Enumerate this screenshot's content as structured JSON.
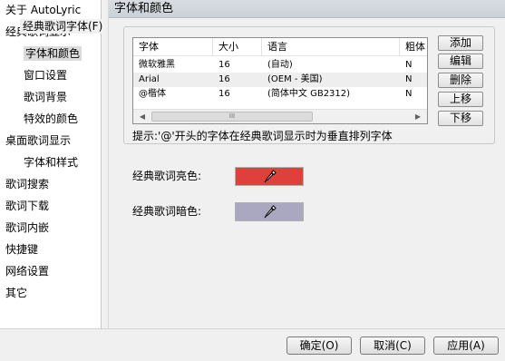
{
  "sidebar": {
    "items": [
      {
        "label": "关于 AutoLyric"
      },
      {
        "label": "经典歌词显示"
      },
      {
        "label": "字体和颜色"
      },
      {
        "label": "窗口设置"
      },
      {
        "label": "歌词背景"
      },
      {
        "label": "特效的颜色"
      },
      {
        "label": "桌面歌词显示"
      },
      {
        "label": "字体和样式"
      },
      {
        "label": "歌词搜索"
      },
      {
        "label": "歌词下载"
      },
      {
        "label": "歌词内嵌"
      },
      {
        "label": "快捷键"
      },
      {
        "label": "网络设置"
      },
      {
        "label": "其它"
      }
    ]
  },
  "main": {
    "section_title": "字体和颜色",
    "group_label": "经典歌词字体(F)",
    "table": {
      "columns": [
        "字体",
        "大小",
        "语言",
        "粗体"
      ],
      "rows": [
        [
          "微软雅黑",
          "16",
          "(自动)",
          "N"
        ],
        [
          "Arial",
          "16",
          "(OEM - 美国)",
          "N"
        ],
        [
          "@楷体",
          "16",
          "(简体中文 GB2312)",
          "N"
        ]
      ],
      "scroll_thumb_grip": "III"
    },
    "buttons": {
      "add": "添加",
      "edit": "编辑",
      "delete": "删除",
      "up": "上移",
      "down": "下移"
    },
    "hint": "提示:'@'开头的字体在经典歌词显示时为垂直排列字体",
    "bright_color": {
      "label": "经典歌词亮色:",
      "color": "#e0403c",
      "icon": "eyedropper-icon"
    },
    "dark_color": {
      "label": "经典歌词暗色:",
      "color": "#a9a8c0",
      "icon": "eyedropper-icon"
    }
  },
  "footer": {
    "ok": "确定(O)",
    "cancel": "取消(C)",
    "apply": "应用(A)"
  }
}
